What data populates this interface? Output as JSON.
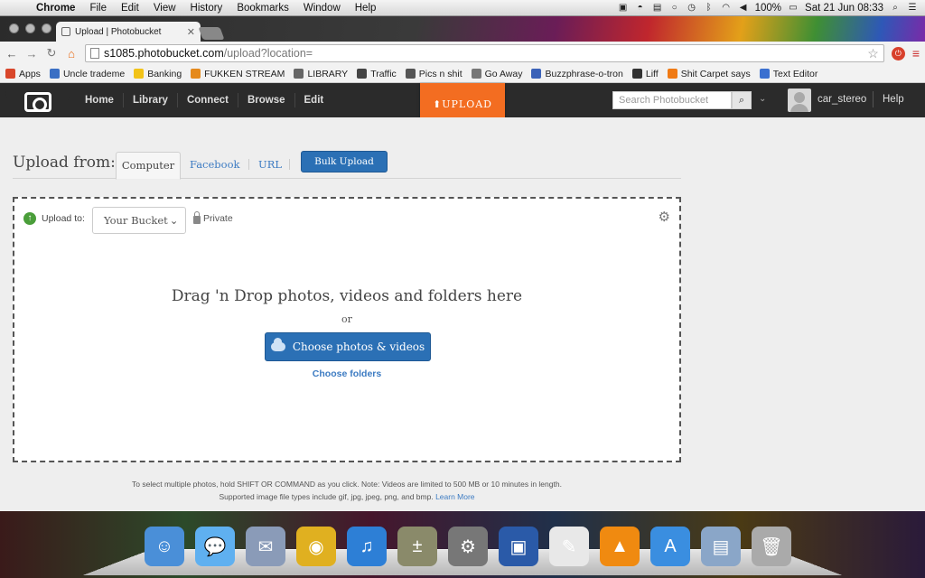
{
  "menubar": {
    "app": "Chrome",
    "items": [
      "File",
      "Edit",
      "View",
      "History",
      "Bookmarks",
      "Window",
      "Help"
    ],
    "battery": "100%",
    "datetime": "Sat 21 Jun  08:33"
  },
  "browser": {
    "tab_title": "Upload | Photobucket",
    "url_host": "s1085.photobucket.com",
    "url_path": "/upload?location="
  },
  "bookmarks": [
    {
      "label": "Apps",
      "color": "#d9472b"
    },
    {
      "label": "Uncle trademe",
      "color": "#3a6fc4"
    },
    {
      "label": "Banking",
      "color": "#f2c318"
    },
    {
      "label": "FUKKEN STREAM",
      "color": "#e58a1c"
    },
    {
      "label": "LIBRARY",
      "color": "#666666"
    },
    {
      "label": "Traffic",
      "color": "#444444"
    },
    {
      "label": "Pics n shit",
      "color": "#555555"
    },
    {
      "label": "Go Away",
      "color": "#777777"
    },
    {
      "label": "Buzzphrase-o-tron",
      "color": "#3b62b8"
    },
    {
      "label": "Liff",
      "color": "#333333"
    },
    {
      "label": "Shit Carpet says",
      "color": "#f07a14"
    },
    {
      "label": "Text Editor",
      "color": "#3b70d0"
    }
  ],
  "pb": {
    "nav": [
      "Home",
      "Library",
      "Connect",
      "Browse",
      "Edit"
    ],
    "upload": "UPLOAD",
    "search_placeholder": "Search Photobucket",
    "username": "car_stereo",
    "help": "Help"
  },
  "upload": {
    "from_label": "Upload from:",
    "tabs": [
      "Computer",
      "Facebook",
      "URL"
    ],
    "bulk": "Bulk Upload",
    "upload_to": "Upload to:",
    "bucket": "Your Bucket",
    "privacy": "Private",
    "dnd": "Drag 'n Drop photos, videos and folders here",
    "or": "or",
    "choose_button": "Choose photos & videos",
    "choose_folders": "Choose folders",
    "note_line1": "To select multiple photos, hold SHIFT OR COMMAND as you click. Note: Videos are limited to 500 MB or 10 minutes in length.",
    "note_line2": "Supported image file types include gif, jpg, jpeg, png, and bmp.",
    "learn_more": "Learn More"
  },
  "dock": [
    {
      "name": "finder-icon",
      "color": "#4a8fd8",
      "glyph": "☺"
    },
    {
      "name": "messages-icon",
      "color": "#5fb0f0",
      "glyph": "💬"
    },
    {
      "name": "mail-icon",
      "color": "#8a9bb8",
      "glyph": "✉"
    },
    {
      "name": "chrome-icon",
      "color": "#e0b020",
      "glyph": "◉"
    },
    {
      "name": "itunes-icon",
      "color": "#2d7fd6",
      "glyph": "♫"
    },
    {
      "name": "calculator-icon",
      "color": "#8a8a6a",
      "glyph": "±"
    },
    {
      "name": "system-preferences-icon",
      "color": "#777777",
      "glyph": "⚙"
    },
    {
      "name": "virtualbox-icon",
      "color": "#2a5aa8",
      "glyph": "▣"
    },
    {
      "name": "textedit-icon",
      "color": "#e8e8e8",
      "glyph": "✎"
    },
    {
      "name": "vlc-icon",
      "color": "#f08a10",
      "glyph": "▲"
    },
    {
      "name": "app-store-icon",
      "color": "#3a8ee0",
      "glyph": "A"
    },
    {
      "name": "downloads-folder-icon",
      "color": "#8aa6c8",
      "glyph": "▤"
    },
    {
      "name": "trash-icon",
      "color": "#aaaaaa",
      "glyph": "🗑"
    }
  ]
}
